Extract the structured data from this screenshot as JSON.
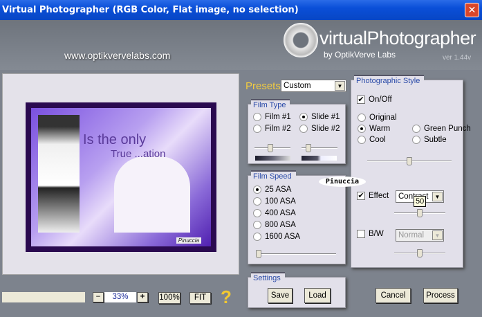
{
  "window": {
    "title": "Virtual Photographer (RGB Color, Flat image, no selection)",
    "close": "✕"
  },
  "header": {
    "url": "www.optikvervelabs.com",
    "brand": "virtualPhotographer",
    "by": "by OptikVerve Labs",
    "version": "ver 1.44v"
  },
  "preview": {
    "caption_line1": "Is the only",
    "caption_line2": "True ...ation",
    "signature": "Pinuccia"
  },
  "presets": {
    "label": "Presets",
    "value": "Custom"
  },
  "film_type": {
    "title": "Film Type",
    "options": [
      {
        "label": "Film #1",
        "selected": false
      },
      {
        "label": "Slide #1",
        "selected": true
      },
      {
        "label": "Film #2",
        "selected": false
      },
      {
        "label": "Slide #2",
        "selected": false
      }
    ],
    "slider1": 0.45,
    "slider2": 0.2
  },
  "film_speed": {
    "title": "Film Speed",
    "options": [
      {
        "label": "25 ASA",
        "selected": true
      },
      {
        "label": "100 ASA",
        "selected": false
      },
      {
        "label": "400 ASA",
        "selected": false
      },
      {
        "label": "800 ASA",
        "selected": false
      },
      {
        "label": "1600 ASA",
        "selected": false
      }
    ],
    "slider": 0.02
  },
  "watermark": "Pinuccia",
  "style": {
    "title": "Photographic Style",
    "on_off": {
      "label": "On/Off",
      "checked": true
    },
    "options": [
      {
        "label": "Original",
        "selected": false
      },
      {
        "label": "Warm",
        "selected": true
      },
      {
        "label": "Cool",
        "selected": false
      },
      {
        "label": "Green Punch",
        "selected": false
      },
      {
        "label": "Subtle",
        "selected": false
      }
    ],
    "slider": 0.5,
    "effect": {
      "label": "Effect",
      "checked": true,
      "value": "Contrast",
      "tooltip": "50",
      "slider": 0.5
    },
    "bw": {
      "label": "B/W",
      "checked": false,
      "value": "Normal",
      "slider": 0.5
    }
  },
  "zoom": {
    "minus": "−",
    "value": "33%",
    "plus": "+",
    "full": "100%",
    "fit": "FIT",
    "help": "?"
  },
  "settings": {
    "title": "Settings",
    "save": "Save",
    "load": "Load"
  },
  "actions": {
    "cancel": "Cancel",
    "process": "Process"
  }
}
